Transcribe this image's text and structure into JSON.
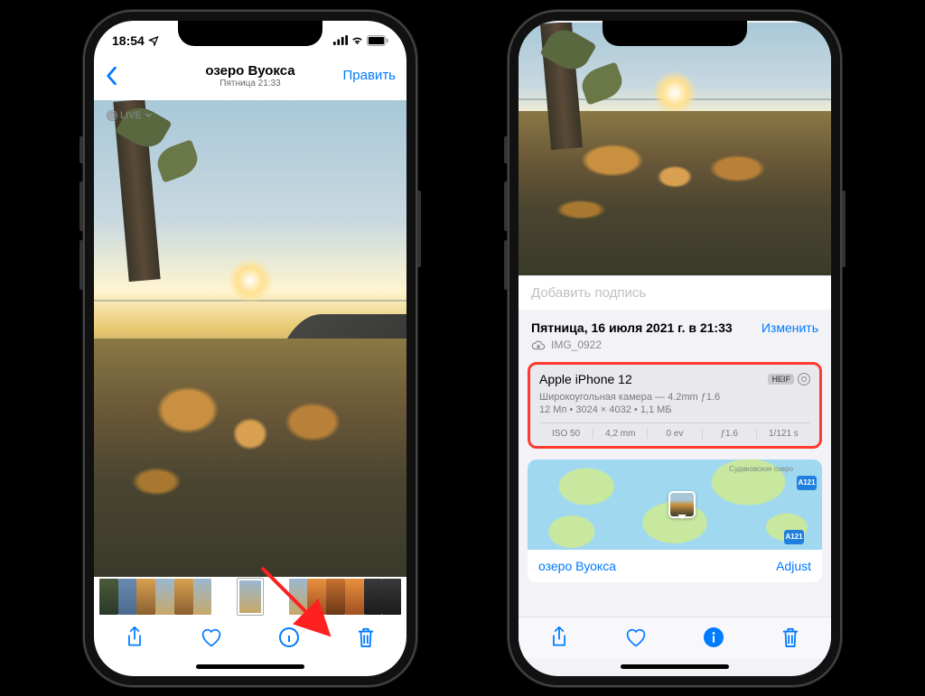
{
  "status": {
    "time": "18:54"
  },
  "left": {
    "title": "озеро Вуокса",
    "subtitle": "Пятница 21:33",
    "edit": "Править",
    "live": "LIVE"
  },
  "right": {
    "caption_placeholder": "Добавить подпись",
    "date": "Пятница, 16 июля 2021 г. в 21:33",
    "change": "Изменить",
    "filename": "IMG_0922",
    "exif": {
      "device": "Apple iPhone 12",
      "format": "HEIF",
      "lens": "Широкоугольная камера — 4.2mm ƒ1.6",
      "meta": "12 Мп  •  3024 × 4032  •  1,1 МБ",
      "iso": "ISO 50",
      "focal": "4,2 mm",
      "ev": "0 ev",
      "aperture": "ƒ1.6",
      "shutter": "1/121 s"
    },
    "map": {
      "label": "Судаковское озеро",
      "road1": "A121",
      "road2": "A121",
      "location": "озеро Вуокса",
      "adjust": "Adjust"
    }
  }
}
